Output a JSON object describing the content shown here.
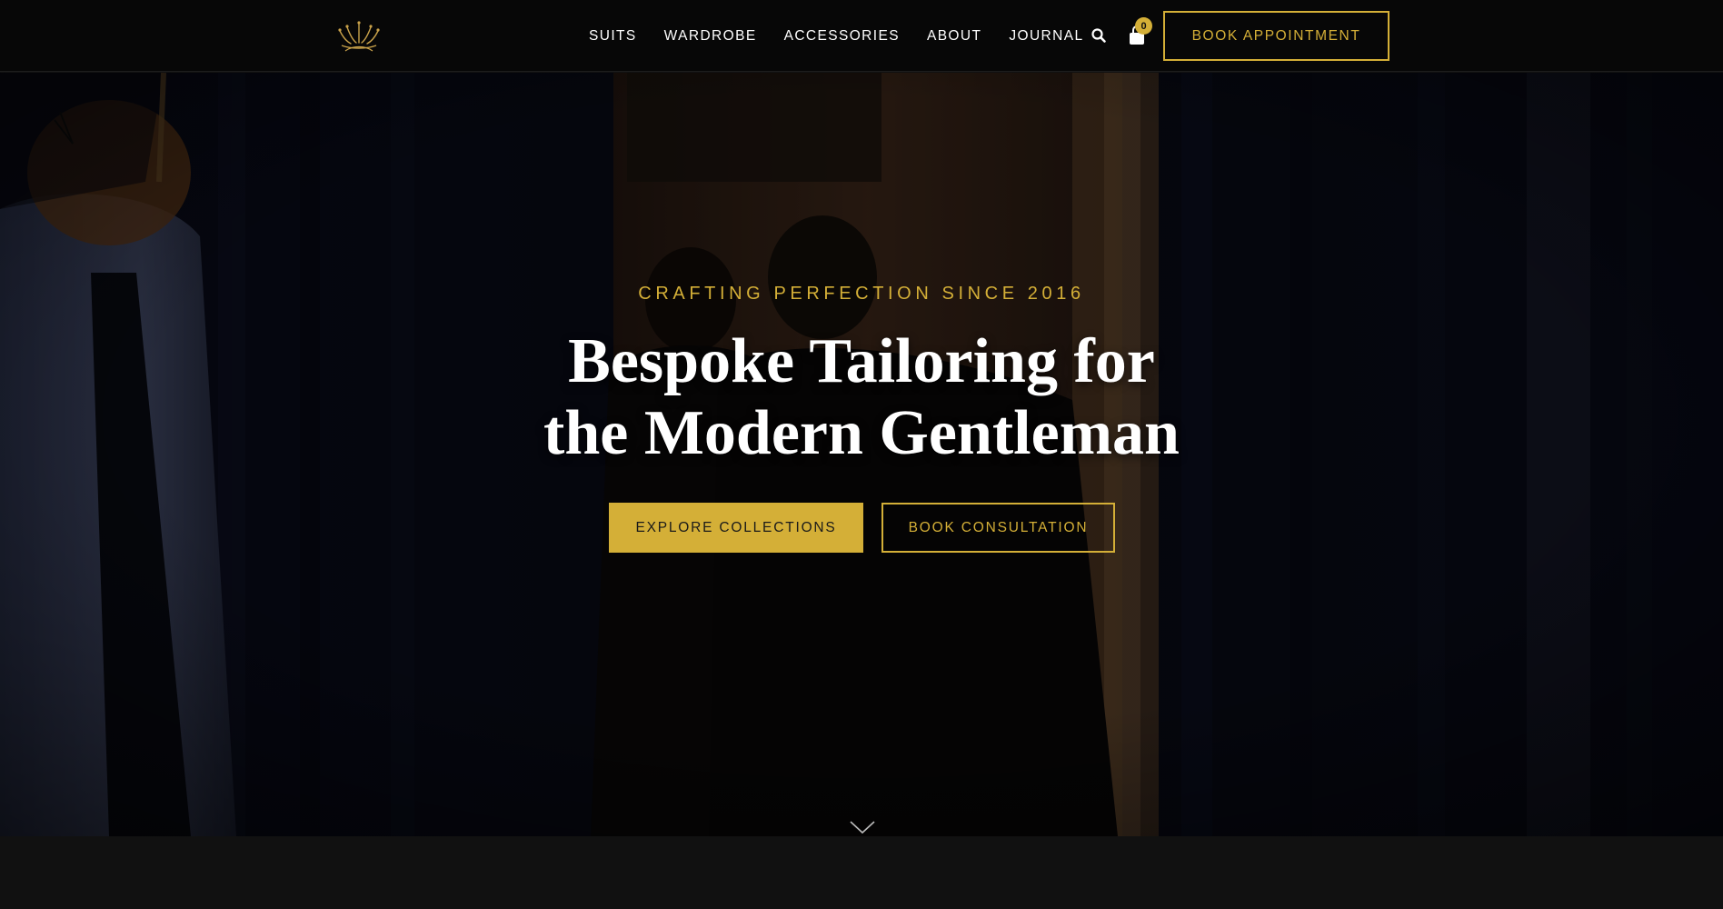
{
  "brand": {
    "logo_icon": "crown-logo-icon"
  },
  "nav": {
    "items": [
      {
        "label": "SUITS"
      },
      {
        "label": "WARDROBE"
      },
      {
        "label": "ACCESSORIES"
      },
      {
        "label": "ABOUT"
      },
      {
        "label": "JOURNAL"
      }
    ],
    "search_icon": "search-icon",
    "cart_icon": "shopping-bag-icon",
    "cart_count": "0",
    "book_appointment_label": "BOOK APPOINTMENT"
  },
  "hero": {
    "eyebrow": "CRAFTING PERFECTION SINCE 2016",
    "headline_line1": "Bespoke Tailoring for",
    "headline_line2": "the Modern Gentleman",
    "primary_cta": "EXPLORE COLLECTIONS",
    "secondary_cta": "BOOK CONSULTATION",
    "scroll_icon": "chevron-down-icon"
  },
  "colors": {
    "accent_gold": "#d4af37",
    "header_bg": "#070707",
    "page_bg": "#111111"
  }
}
